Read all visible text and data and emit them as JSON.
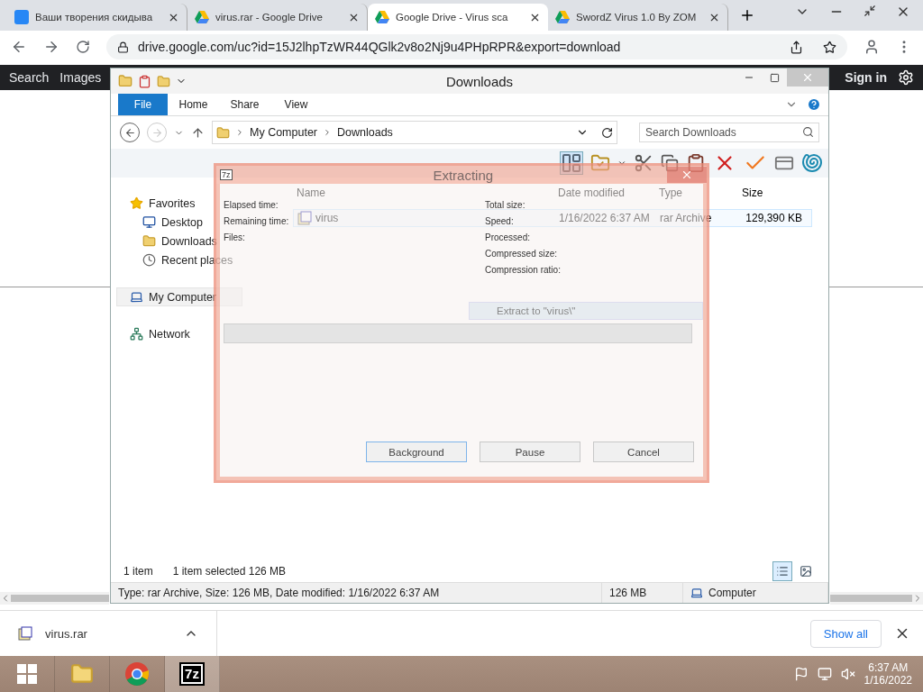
{
  "browser": {
    "tabs": [
      {
        "title": "Ваши творения скидыва",
        "kind": "vk",
        "selected": false
      },
      {
        "title": "virus.rar - Google Drive",
        "kind": "drive",
        "selected": false
      },
      {
        "title": "Google Drive - Virus sca",
        "kind": "drive",
        "selected": true
      },
      {
        "title": "SwordZ Virus 1.0 By ZOM",
        "kind": "drive",
        "selected": false
      }
    ],
    "url": "drive.google.com/uc?id=15J2lhpTzWR44QGlk2v8o2Nj9u4PHpRPR&export=download"
  },
  "page": {
    "nav": [
      "Search",
      "Images"
    ],
    "sign_in": "Sign in"
  },
  "explorer": {
    "title": "Downloads",
    "ribbon_tabs": [
      {
        "label": "File",
        "selected": true
      },
      {
        "label": "Home",
        "selected": false
      },
      {
        "label": "Share",
        "selected": false
      },
      {
        "label": "View",
        "selected": false
      }
    ],
    "breadcrumb": [
      "My Computer",
      "Downloads"
    ],
    "search": {
      "placeholder": "Search Downloads"
    },
    "columns": [
      "Name",
      "Date modified",
      "Type",
      "Size"
    ],
    "files": [
      {
        "name": "virus",
        "date": "1/16/2022 6:37 AM",
        "type": "rar Archive",
        "size": "129,390 KB",
        "selected": true
      }
    ],
    "nav": [
      {
        "label": "Favorites",
        "kind": "star",
        "selected": false,
        "children": [
          {
            "label": "Desktop",
            "kind": "desktop",
            "selected": false
          },
          {
            "label": "Downloads",
            "kind": "folder",
            "selected": false
          },
          {
            "label": "Recent places",
            "kind": "recent",
            "selected": false
          }
        ]
      },
      {
        "label": "My Computer",
        "kind": "computer",
        "selected": true
      },
      {
        "label": "Network",
        "kind": "network",
        "selected": false
      }
    ],
    "status": {
      "count": "1 item",
      "selection": "1 item selected  126 MB"
    },
    "details_bar": {
      "info": "Type: rar Archive, Size: 126 MB, Date modified: 1/16/2022 6:37 AM",
      "size": "126 MB",
      "location": "Computer"
    }
  },
  "dialog": {
    "icon_text": "7z",
    "title": "Extracting",
    "left_fields": [
      "Elapsed time:",
      "Remaining time:",
      "Files:"
    ],
    "right_fields": [
      "Total size:",
      "Speed:",
      "Processed:",
      "Compressed size:",
      "Compression ratio:"
    ],
    "path": "Extract to \"virus\\\"",
    "progress": {
      "level": 0
    },
    "buttons": [
      {
        "label": "Background",
        "selected": true
      },
      {
        "label": "Pause",
        "selected": false
      },
      {
        "label": "Cancel",
        "selected": false
      }
    ]
  },
  "downloads": {
    "file": "virus.rar",
    "show_all": "Show all"
  },
  "taskbar": {
    "apps": [
      {
        "kind": "explorer"
      },
      {
        "kind": "chrome"
      },
      {
        "kind": "sevenzip",
        "label": "7z"
      }
    ],
    "time": "6:37 AM",
    "date": "1/16/2022"
  }
}
